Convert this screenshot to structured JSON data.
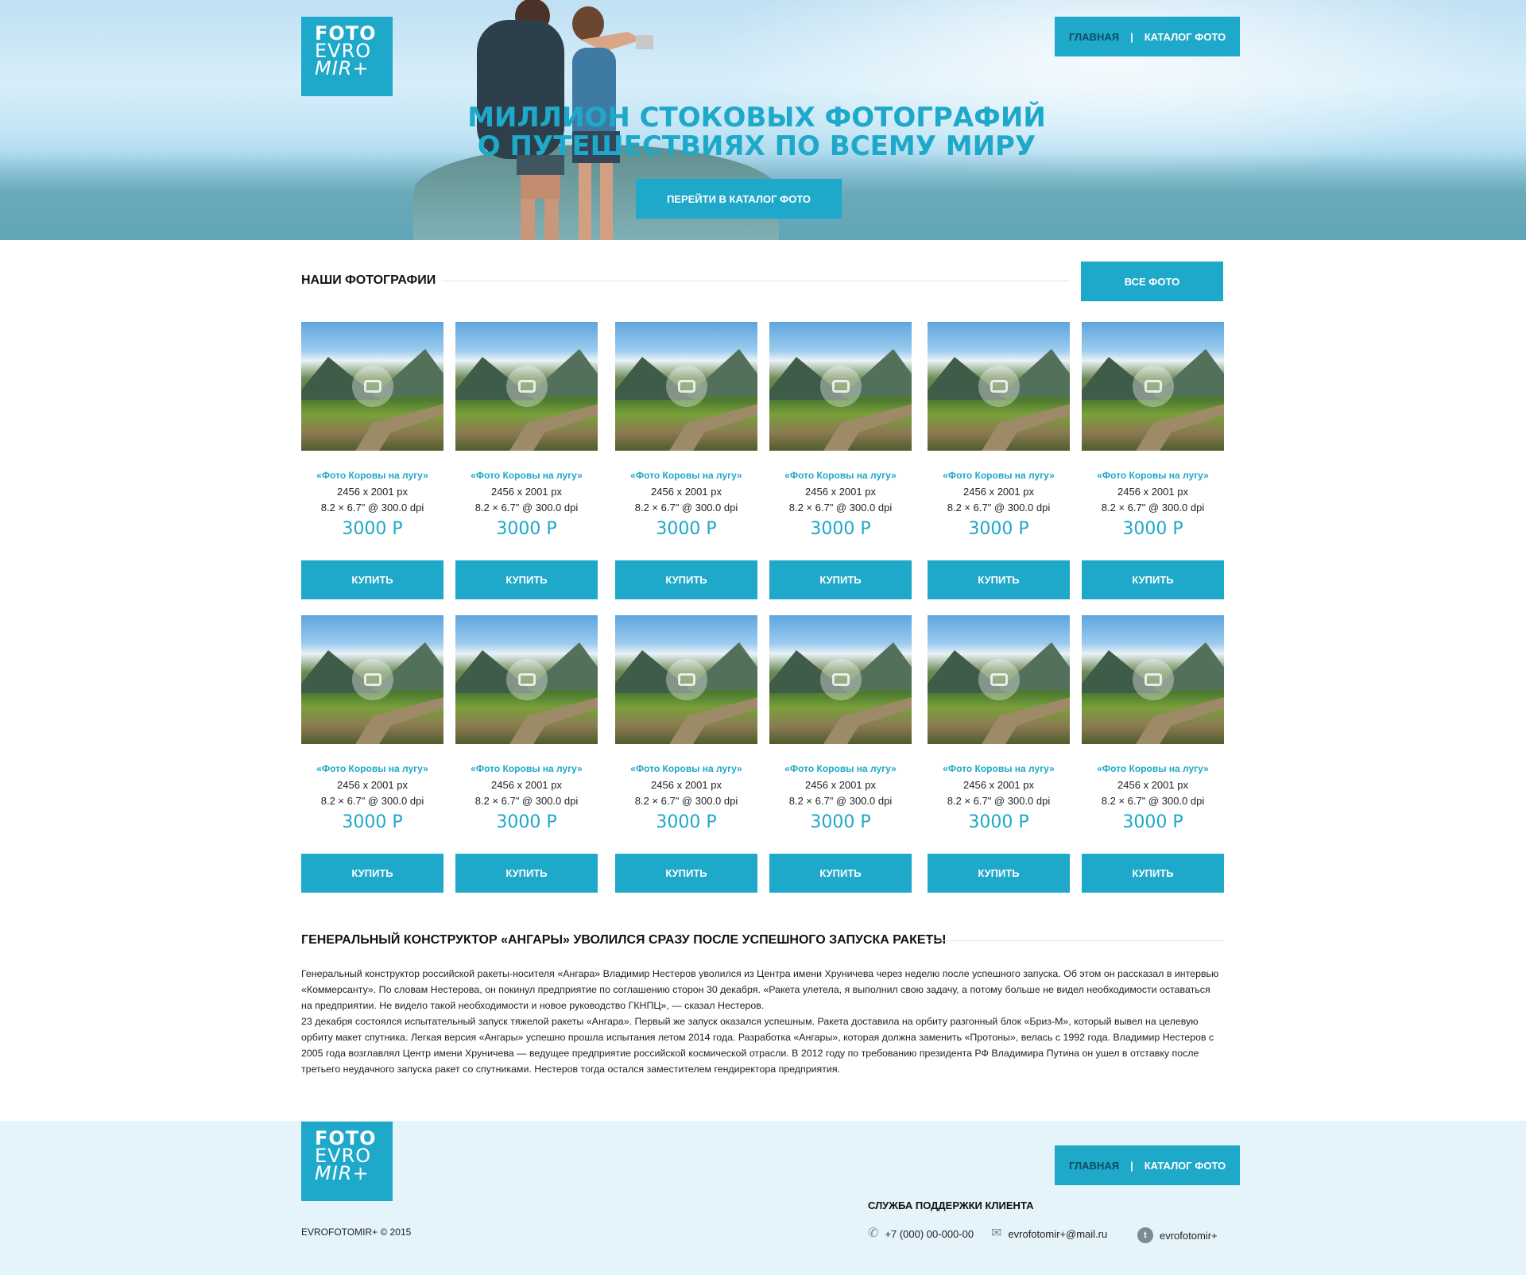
{
  "brand": {
    "line1": "FOTO",
    "line2": "EVRO",
    "line3": "MIR+"
  },
  "nav": {
    "home": "ГЛАВНАЯ",
    "separator": "|",
    "catalog": "КАТАЛОГ ФОТО"
  },
  "hero": {
    "title_line1": "МИЛЛИОН СТОКОВЫХ ФОТОГРАФИЙ",
    "title_line2": "О ПУТЕШЕСТВИЯХ ПО ВСЕМУ МИРУ",
    "button": "ПЕРЕЙТИ В КАТАЛОГ ФОТО"
  },
  "photos_section": {
    "title": "НАШИ ФОТОГРАФИИ",
    "all_button": "ВСЕ ФОТО"
  },
  "photos": [
    {
      "title": "«Фото Коровы на лугу»",
      "size": "2456 x 2001 px",
      "print": "8.2 × 6.7\" @ 300.0 dpi",
      "price": "3000 Р",
      "buy": "КУПИТЬ"
    },
    {
      "title": "«Фото Коровы на лугу»",
      "size": "2456 x 2001 px",
      "print": "8.2 × 6.7\" @ 300.0 dpi",
      "price": "3000 Р",
      "buy": "КУПИТЬ"
    },
    {
      "title": "«Фото Коровы на лугу»",
      "size": "2456 x 2001 px",
      "print": "8.2 × 6.7\" @ 300.0 dpi",
      "price": "3000 Р",
      "buy": "КУПИТЬ"
    },
    {
      "title": "«Фото Коровы на лугу»",
      "size": "2456 x 2001 px",
      "print": "8.2 × 6.7\" @ 300.0 dpi",
      "price": "3000 Р",
      "buy": "КУПИТЬ"
    },
    {
      "title": "«Фото Коровы на лугу»",
      "size": "2456 x 2001 px",
      "print": "8.2 × 6.7\" @ 300.0 dpi",
      "price": "3000 Р",
      "buy": "КУПИТЬ"
    },
    {
      "title": "«Фото Коровы на лугу»",
      "size": "2456 x 2001 px",
      "print": "8.2 × 6.7\" @ 300.0 dpi",
      "price": "3000 Р",
      "buy": "КУПИТЬ"
    },
    {
      "title": "«Фото Коровы на лугу»",
      "size": "2456 x 2001 px",
      "print": "8.2 × 6.7\" @ 300.0 dpi",
      "price": "3000 Р",
      "buy": "КУПИТЬ"
    },
    {
      "title": "«Фото Коровы на лугу»",
      "size": "2456 x 2001 px",
      "print": "8.2 × 6.7\" @ 300.0 dpi",
      "price": "3000 Р",
      "buy": "КУПИТЬ"
    },
    {
      "title": "«Фото Коровы на лугу»",
      "size": "2456 x 2001 px",
      "print": "8.2 × 6.7\" @ 300.0 dpi",
      "price": "3000 Р",
      "buy": "КУПИТЬ"
    },
    {
      "title": "«Фото Коровы на лугу»",
      "size": "2456 x 2001 px",
      "print": "8.2 × 6.7\" @ 300.0 dpi",
      "price": "3000 Р",
      "buy": "КУПИТЬ"
    },
    {
      "title": "«Фото Коровы на лугу»",
      "size": "2456 x 2001 px",
      "print": "8.2 × 6.7\" @ 300.0 dpi",
      "price": "3000 Р",
      "buy": "КУПИТЬ"
    },
    {
      "title": "«Фото Коровы на лугу»",
      "size": "2456 x 2001 px",
      "print": "8.2 × 6.7\" @ 300.0 dpi",
      "price": "3000 Р",
      "buy": "КУПИТЬ"
    }
  ],
  "article": {
    "title": "ГЕНЕРАЛЬНЫЙ КОНСТРУКТОР «АНГАРЫ» УВОЛИЛСЯ СРАЗУ ПОСЛЕ УСПЕШНОГО ЗАПУСКА РАКЕТЫ",
    "p1": "Генеральный конструктор российской ракеты-носителя «Ангара» Владимир Нестеров уволился из Центра имени Хруничева через неделю после успешного запуска. Об этом он рассказал в интервью «Коммерсанту». По словам Нестерова, он покинул предприятие по соглашению сторон 30 декабря. «Ракета улетела, я выполнил свою задачу, а потому больше не видел необходимости оставаться на предприятии. Не видело такой необходимости и новое руководство ГКНПЦ», — сказал Нестеров.",
    "p2": "23 декабря состоялся испытательный запуск тяжелой ракеты «Ангара». Первый же запуск оказался успешным. Ракета доставила на орбиту разгонный блок «Бриз-М», который вывел на целевую орбиту макет спутника. Легкая версия «Ангары» успешно прошла испытания летом 2014 года. Разработка «Ангары», которая должна заменить «Протоны», велась с 1992 года. Владимир Нестеров с 2005 года возглавлял Центр имени Хруничева — ведущее предприятие российской космической отрасли. В 2012 году по требованию президента РФ Владимира Путина он ушел в отставку после третьего неудачного запуска ракет со спутниками. Нестеров тогда остался заместителем гендиректора предприятия."
  },
  "footer": {
    "copyright": "EVROFOTOMIR+ © 2015",
    "support_title": "СЛУЖБА ПОДДЕРЖКИ КЛИЕНТА",
    "phone": "+7 (000) 00-000-00",
    "email": "evrofotomir+@mail.ru",
    "twitter": "evrofotomir+"
  },
  "colors": {
    "accent": "#1ea8c9",
    "footer_bg": "#e4f4fa"
  }
}
